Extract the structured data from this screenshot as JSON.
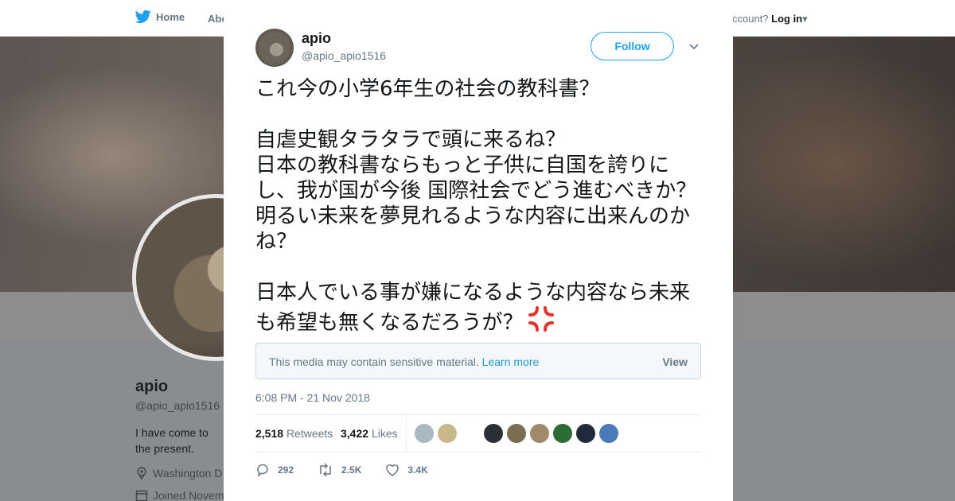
{
  "topnav": {
    "home_label": "Home",
    "about_label": "Abo",
    "account_prompt": "ccount?",
    "login_label": "Log in"
  },
  "profile": {
    "name": "apio",
    "handle": "@apio_apio1516",
    "bio": "I have come to the present.",
    "location": "Washington D",
    "joined": "Joined Novem"
  },
  "tweet": {
    "author_name": "apio",
    "author_handle": "@apio_apio1516",
    "follow_label": "Follow",
    "text": "これ今の小学6年生の社会の教科書？\n\n自虐史観タラタラで頭に来るね？\n日本の教科書ならもっと子供に自国を誇りにし、我が国が今後 国際社会でどう進むべきか？明るい未来を夢見れるような内容に出来んのかね？\n\n日本人でいる事が嫌になるような内容なら未来も希望も無くなるだろうが？",
    "emoji_name": "anger-symbol-icon",
    "sensitive_notice": "This media may contain sensitive material.",
    "learn_more": "Learn more",
    "view_label": "View",
    "timestamp": "6:08 PM - 21 Nov 2018",
    "retweets_count": "2,518",
    "retweets_label": "Retweets",
    "likes_count": "3,422",
    "likes_label": "Likes",
    "reply_count": "292",
    "retweet_count_short": "2.5K",
    "like_count_short": "3.4K"
  },
  "likers": [
    {
      "color": "#aab8c2"
    },
    {
      "color": "#c9b88a"
    },
    {
      "color": "#ffffff"
    },
    {
      "color": "#2c2f35"
    },
    {
      "color": "#7a6e52"
    },
    {
      "color": "#a08a6a"
    },
    {
      "color": "#2d6b35"
    },
    {
      "color": "#1f2a3a"
    },
    {
      "color": "#4a7ab8"
    }
  ],
  "colors": {
    "accent": "#1da1f2",
    "link": "#1b95e0",
    "muted": "#657786",
    "anger": "#e0352b"
  }
}
